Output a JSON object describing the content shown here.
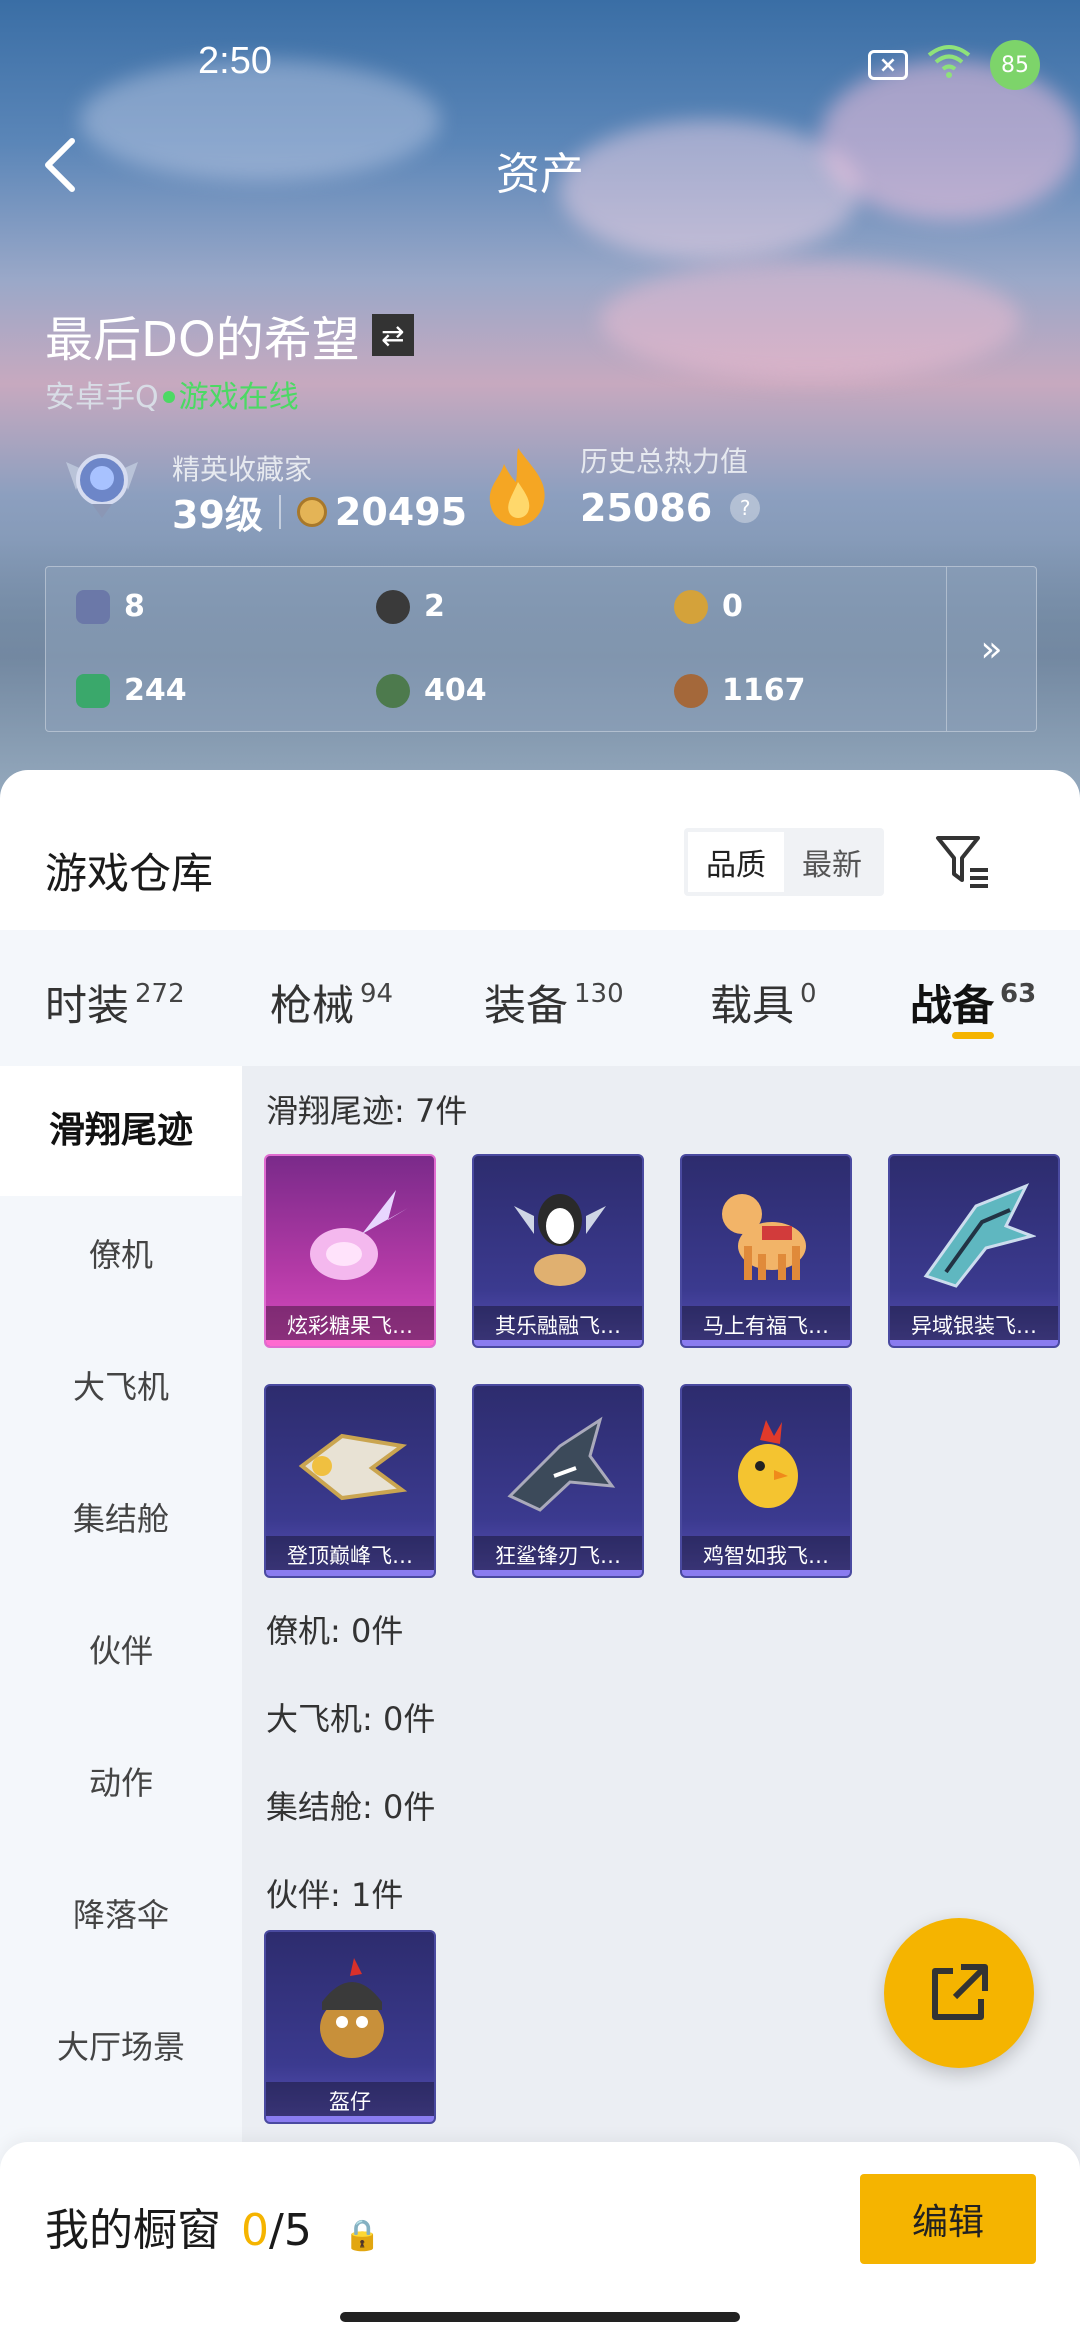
{
  "status": {
    "time": "2:50",
    "battery": "85"
  },
  "header": {
    "title": "资产"
  },
  "profile": {
    "name": "最后DO的希望",
    "platform": "安卓手Q",
    "online_status": "游戏在线",
    "collector_label": "精英收藏家",
    "level": "39级",
    "collector_points": "20495",
    "heat_label": "历史总热力值",
    "heat_value": "25086",
    "help": "?"
  },
  "currencies": [
    {
      "icon": "card-icon",
      "value": "8",
      "color": "#6b78a8"
    },
    {
      "icon": "token-icon",
      "value": "2",
      "color": "#3a3a3a"
    },
    {
      "icon": "gold-coin-icon",
      "value": "0",
      "color": "#d4a23a"
    },
    {
      "icon": "green-card-icon",
      "value": "244",
      "color": "#3aa86b"
    },
    {
      "icon": "orb-icon",
      "value": "404",
      "color": "#4d7a4d"
    },
    {
      "icon": "shell-icon",
      "value": "1167",
      "color": "#a4683a"
    }
  ],
  "warehouse": {
    "title": "游戏仓库",
    "sort": [
      "品质",
      "最新"
    ],
    "tabs": [
      {
        "label": "时装",
        "count": "272"
      },
      {
        "label": "枪械",
        "count": "94"
      },
      {
        "label": "装备",
        "count": "130"
      },
      {
        "label": "载具",
        "count": "0"
      },
      {
        "label": "战备",
        "count": "63"
      }
    ],
    "side": [
      "滑翔尾迹",
      "僚机",
      "大飞机",
      "集结舱",
      "伙伴",
      "动作",
      "降落伞",
      "大厅场景"
    ],
    "sections": {
      "glide": "滑翔尾迹: 7件",
      "wingman": "僚机: 0件",
      "bigplane": "大飞机: 0件",
      "capsule": "集结舱: 0件",
      "partner": "伙伴: 1件"
    },
    "glide_items": [
      "炫彩糖果飞…",
      "其乐融融飞…",
      "马上有福飞…",
      "异域银装飞…",
      "登顶巅峰飞…",
      "狂鲨锋刃飞…",
      "鸡智如我飞…"
    ],
    "partner_items": [
      "盔仔"
    ]
  },
  "showcase": {
    "label": "我的橱窗",
    "current": "0",
    "total": "/5",
    "edit": "编辑"
  }
}
